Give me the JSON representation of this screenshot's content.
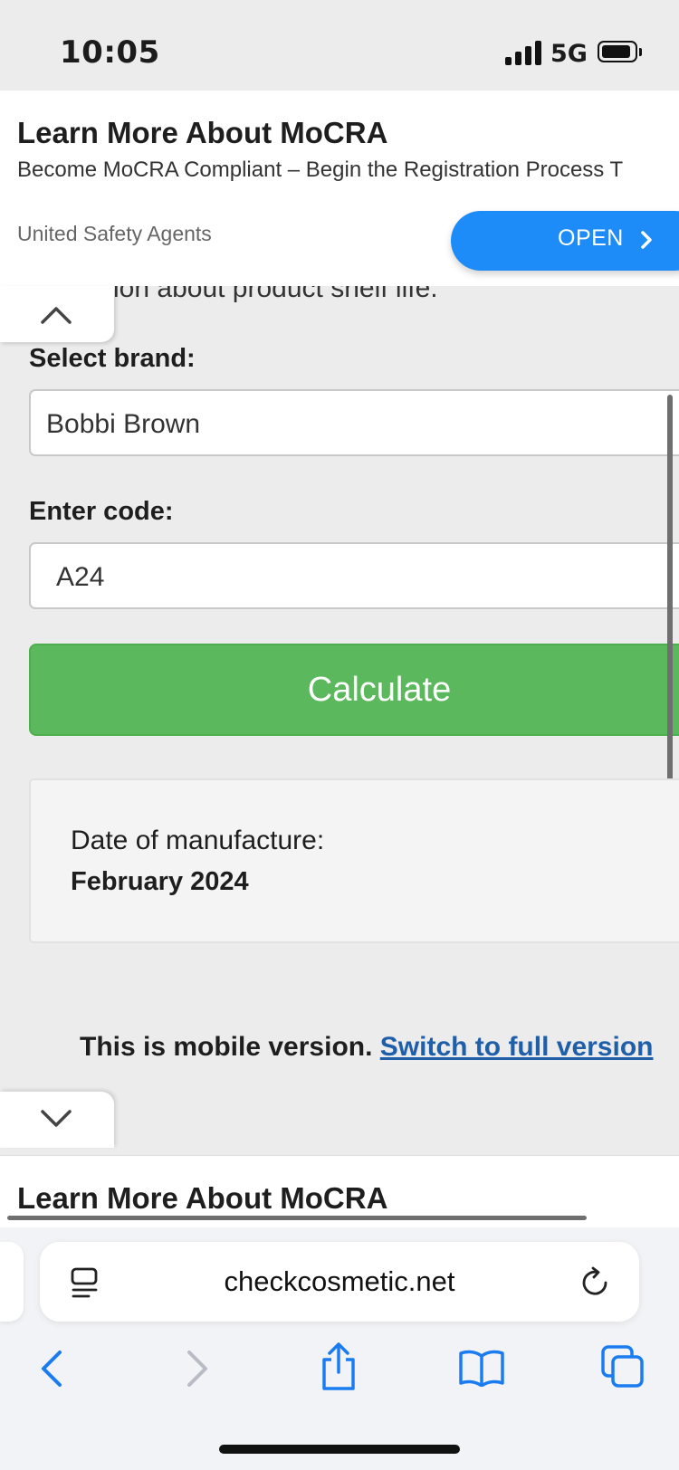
{
  "status_bar": {
    "time": "10:05",
    "network": "5G"
  },
  "ad_top": {
    "title": "Learn More About MoCRA",
    "subtitle": "Become MoCRA Compliant – Begin the Registration Process T",
    "advertiser": "United Safety Agents",
    "open_label": "OPEN"
  },
  "page": {
    "partial_text": "ation about product shelf life.",
    "brand_label": "Select brand:",
    "brand_value": "Bobbi Brown",
    "code_label": "Enter code:",
    "code_value": "A24",
    "calculate_label": "Calculate",
    "result_label": "Date of manufacture:",
    "result_value": "February 2024",
    "mobile_note": "This is mobile version.",
    "full_version_link": "Switch to full version"
  },
  "ad_bottom": {
    "title": "Learn More About MoCRA"
  },
  "browser": {
    "url": "checkcosmetic.net"
  },
  "icons": {
    "tab_collapse": "chevron-up-icon",
    "tab_expand": "chevron-down-icon",
    "url_bar_left": "reader-mode-icon",
    "url_bar_right": "reload-icon",
    "toolbar": [
      "back-icon",
      "forward-icon",
      "share-icon",
      "bookmarks-icon",
      "tabs-icon"
    ]
  },
  "colors": {
    "calculate_button": "#5cb85c",
    "link": "#1f5ea8",
    "ad_open_button": "#1d8cf8",
    "toolbar_icons": "#1a7cf0"
  }
}
